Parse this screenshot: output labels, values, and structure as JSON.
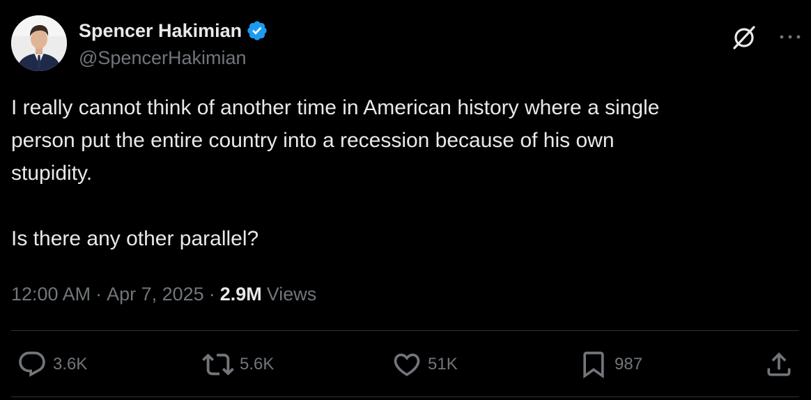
{
  "author": {
    "display_name": "Spencer Hakimian",
    "handle": "@SpencerHakimian",
    "verified": true
  },
  "tweet": {
    "text": "I really cannot think of another time in American history where a single\nperson put the entire country into a recession because of his own\nstupidity.\n\nIs there any other parallel?",
    "time": "12:00 AM",
    "separator": "·",
    "date": "Apr 7, 2025",
    "views_count": "2.9M",
    "views_label": "Views"
  },
  "actions": {
    "replies": "3.6K",
    "reposts": "5.6K",
    "likes": "51K",
    "bookmarks": "987"
  },
  "icons": {
    "header": [
      "grok-icon",
      "more-icon"
    ],
    "actions": [
      "reply-icon",
      "repost-icon",
      "like-icon",
      "bookmark-icon",
      "share-icon"
    ]
  },
  "colors": {
    "background": "#000000",
    "text_primary": "#e7e9ea",
    "text_secondary": "#71767b",
    "verified": "#1d9bf0",
    "divider": "#2f3336"
  }
}
